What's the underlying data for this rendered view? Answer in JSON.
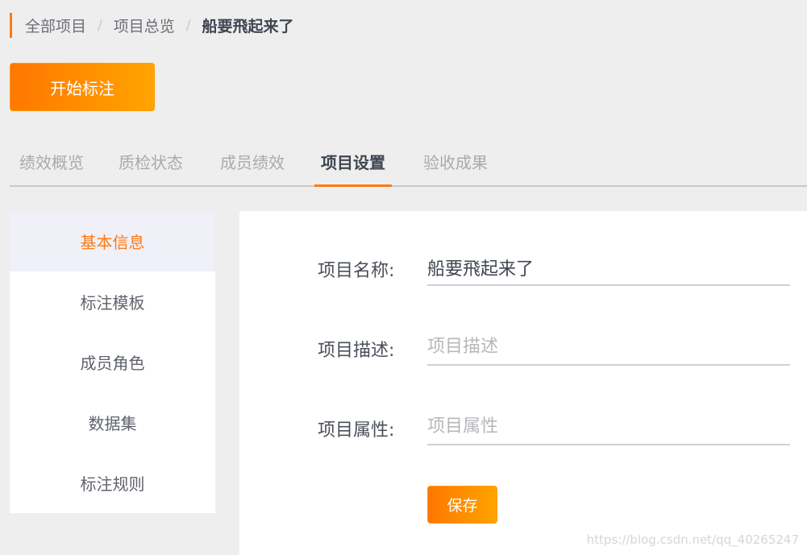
{
  "breadcrumb": {
    "items": [
      "全部项目",
      "项目总览"
    ],
    "separator": "/",
    "current": "船要飛起来了"
  },
  "start_button": {
    "label": "开始标注"
  },
  "tabs": [
    {
      "label": "绩效概览",
      "active": false
    },
    {
      "label": "质检状态",
      "active": false
    },
    {
      "label": "成员绩效",
      "active": false
    },
    {
      "label": "项目设置",
      "active": true
    },
    {
      "label": "验收成果",
      "active": false
    }
  ],
  "side_menu": {
    "items": [
      {
        "label": "基本信息",
        "active": true
      },
      {
        "label": "标注模板",
        "active": false
      },
      {
        "label": "成员角色",
        "active": false
      },
      {
        "label": "数据集",
        "active": false
      },
      {
        "label": "标注规则",
        "active": false
      }
    ]
  },
  "form": {
    "name": {
      "label": "项目名称:",
      "value": "船要飛起来了",
      "placeholder": ""
    },
    "description": {
      "label": "项目描述:",
      "value": "",
      "placeholder": "项目描述"
    },
    "attribute": {
      "label": "项目属性:",
      "value": "",
      "placeholder": "项目属性"
    },
    "save_label": "保存"
  },
  "watermark": "https://blog.csdn.net/qq_40265247",
  "colors": {
    "accent": "#ff7a12",
    "gradient_start": "#ff7700",
    "gradient_end": "#ffa400",
    "background": "#eeeeee",
    "active_menu_bg": "#eff0f8"
  }
}
